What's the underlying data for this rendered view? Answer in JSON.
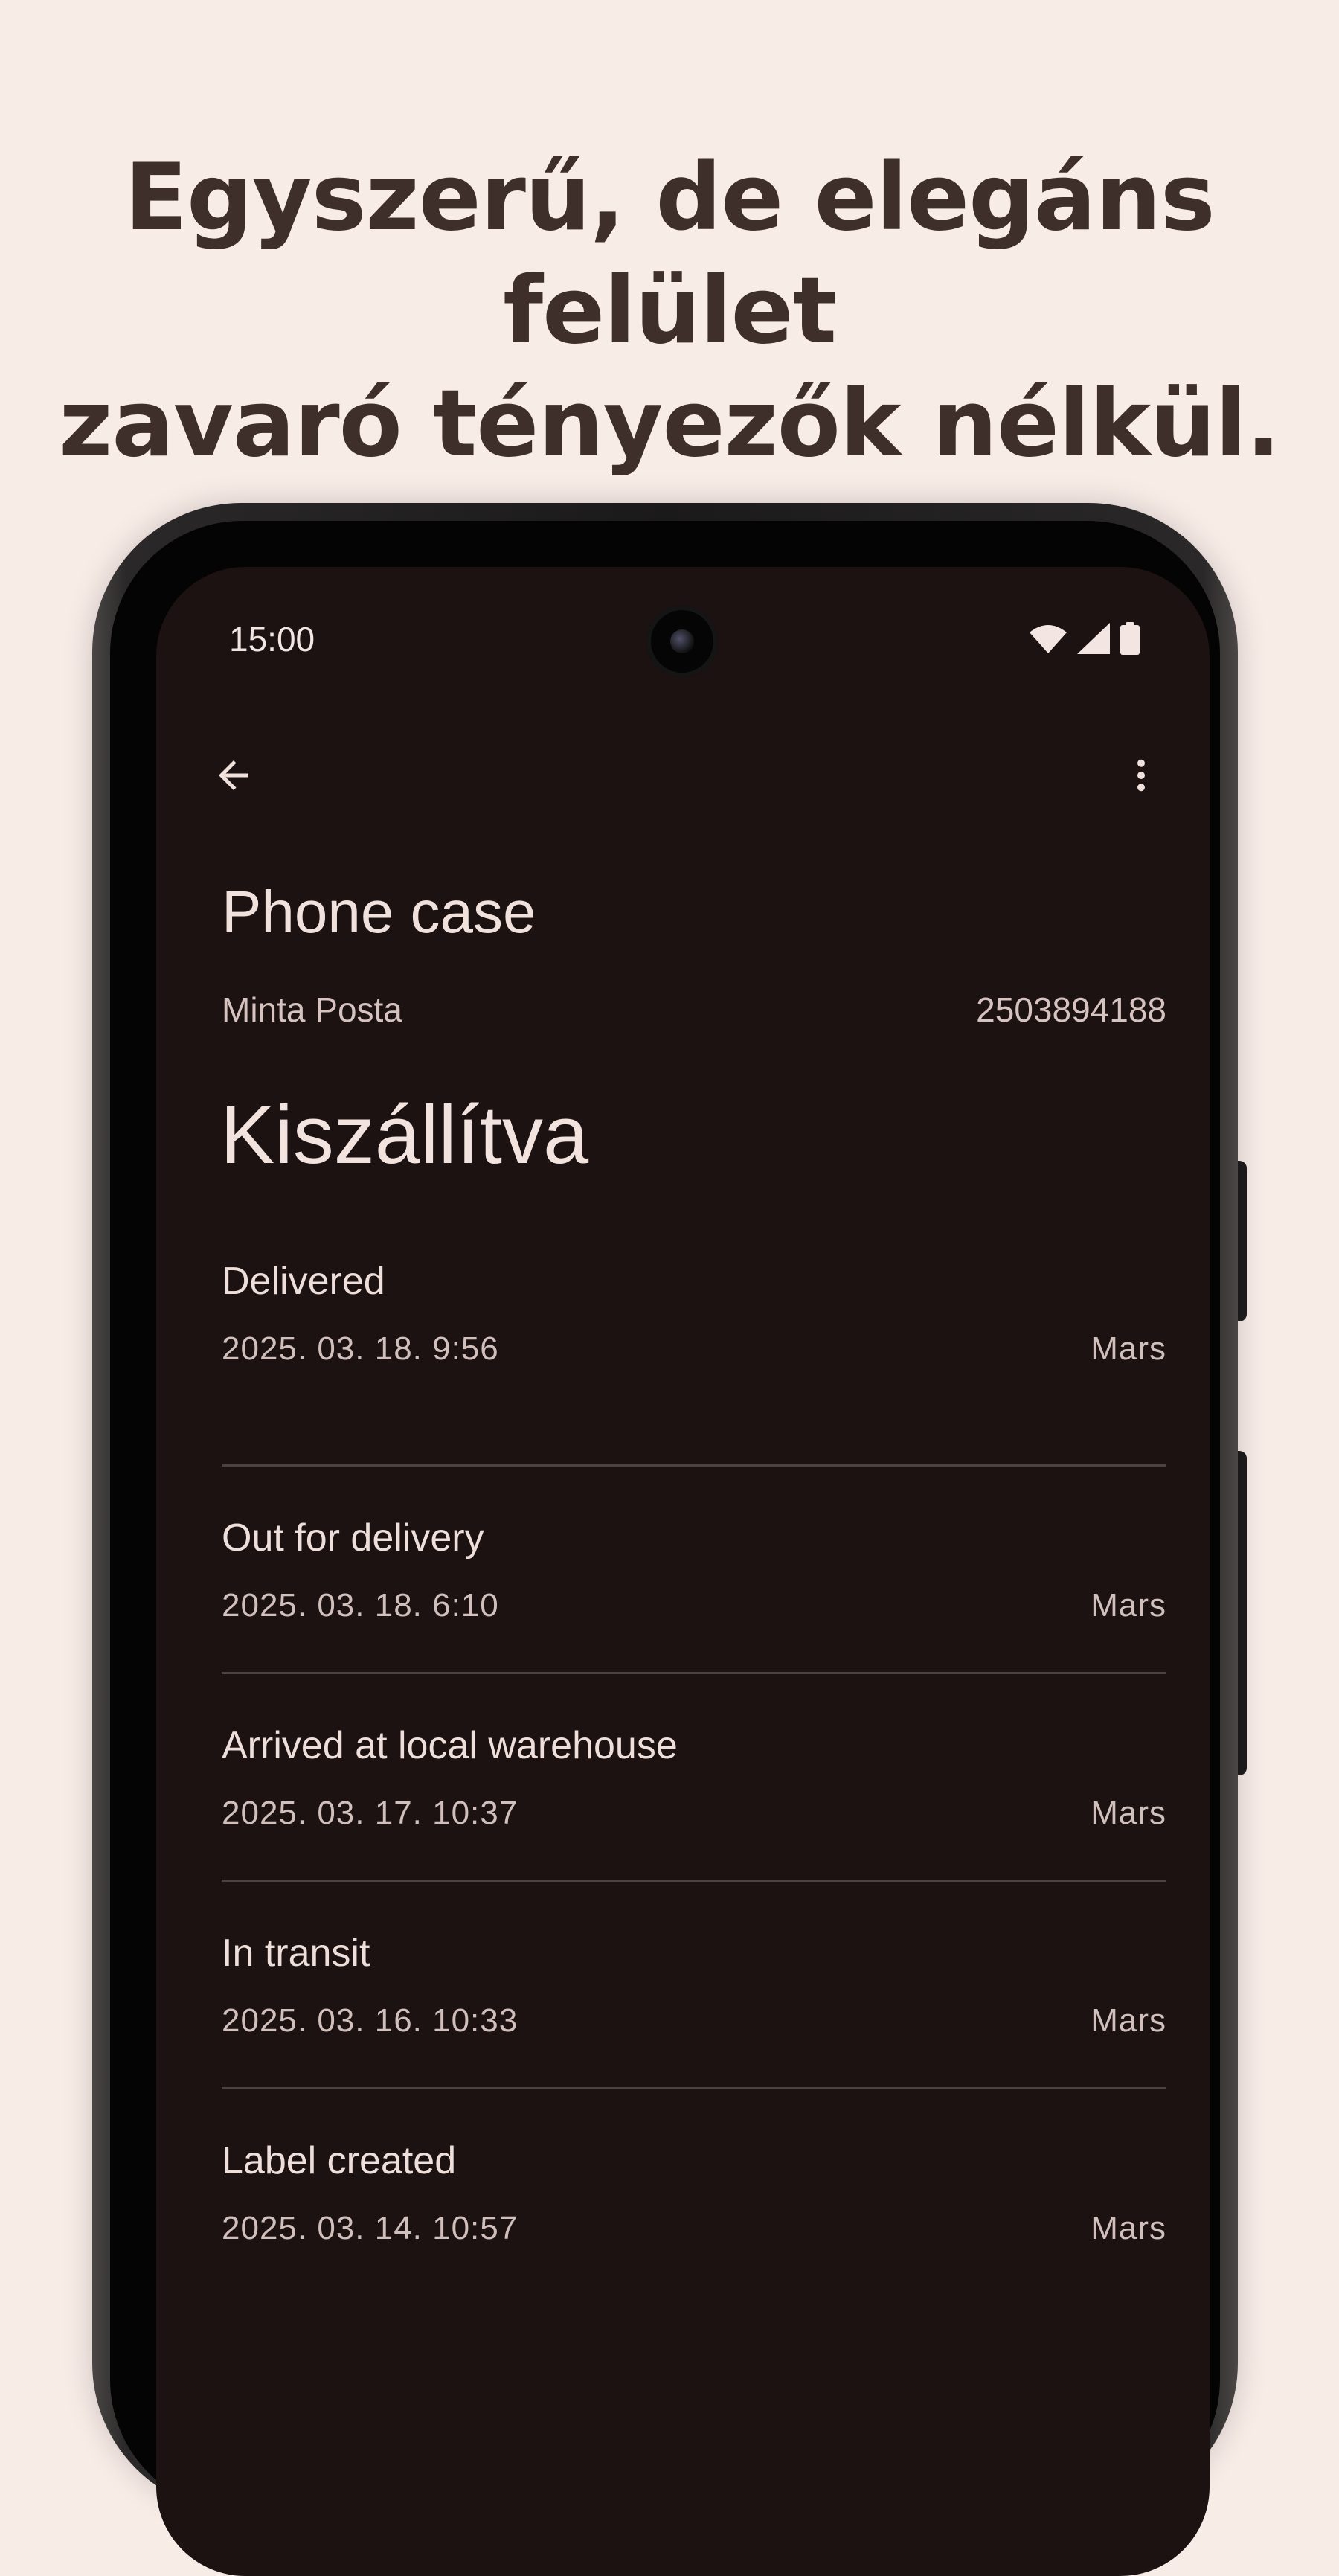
{
  "headline": {
    "line1": "Egyszerű, de elegáns felület",
    "line2": "zavaró tényezők nélkül."
  },
  "status_bar": {
    "time": "15:00",
    "icons": [
      "wifi-icon",
      "signal-icon",
      "battery-icon"
    ]
  },
  "toolbar": {
    "back_icon": "arrow-back-icon",
    "menu_icon": "more-vert-icon"
  },
  "shipment": {
    "title": "Phone case",
    "carrier": "Minta Posta",
    "tracking_number": "2503894188",
    "status": "Kiszállítva"
  },
  "events": [
    {
      "title": "Delivered",
      "time": "2025. 03. 18. 9:56",
      "location": "Mars"
    },
    {
      "title": "Out for delivery",
      "time": "2025. 03. 18. 6:10",
      "location": "Mars"
    },
    {
      "title": "Arrived at local warehouse",
      "time": "2025. 03. 17. 10:37",
      "location": "Mars"
    },
    {
      "title": "In transit",
      "time": "2025. 03. 16. 10:33",
      "location": "Mars"
    },
    {
      "title": "Label created",
      "time": "2025. 03. 14. 10:57",
      "location": "Mars"
    }
  ],
  "colors": {
    "page_background": "#f8ece7",
    "headline_text": "#3e2f2a",
    "screen_background": "#1b1211",
    "primary_text": "#f1e1dd",
    "secondary_text": "#d1bfbb",
    "divider": "#4d4240"
  }
}
